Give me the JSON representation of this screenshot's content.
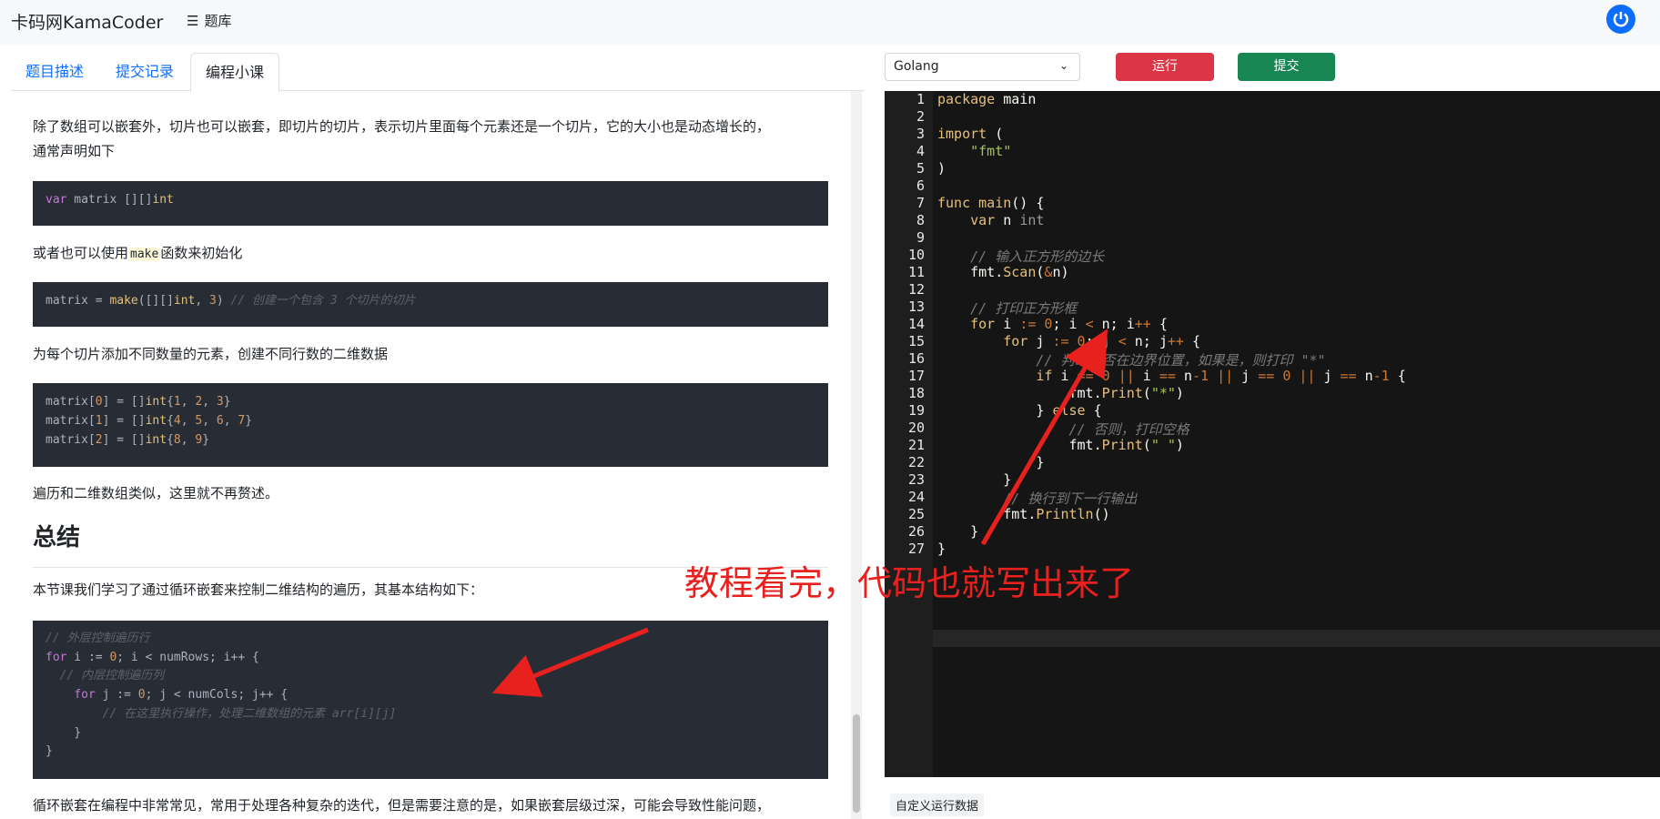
{
  "nav": {
    "brand": "卡码网KamaCoder",
    "menu_label": "题库"
  },
  "tabs": [
    "题目描述",
    "提交记录",
    "编程小课"
  ],
  "lesson": {
    "p1": "除了数组可以嵌套外，切片也可以嵌套，即切片的切片，表示切片里面每个元素还是一个切片，它的大小也是动态增长的，",
    "p1b": "通常声明如下",
    "p2a": "或者也可以使用",
    "p2code": "make",
    "p2b": "函数来初始化",
    "p3": "为每个切片添加不同数量的元素，创建不同行数的二维数据",
    "p4": "遍历和二维数组类似，这里就不再赘述。",
    "h_summary": "总结",
    "p5": "本节课我们学习了通过循环嵌套来控制二维结构的遍历，其基本结构如下：",
    "p6": "循环嵌套在编程中非常常见，常用于处理各种复杂的迭代，但是需要注意的是，如果嵌套层级过深，可能会导致性能问题，"
  },
  "toolbar": {
    "language": "Golang",
    "run": "运行",
    "submit": "提交"
  },
  "editor": {
    "line_count": 27
  },
  "custom_data_label": "自定义运行数据",
  "annotation": "教程看完，代码也就写出来了",
  "colors": {
    "run": "#dc3545",
    "submit": "#198754",
    "tab_link": "#0d6efd",
    "annotation": "#e8211f"
  }
}
